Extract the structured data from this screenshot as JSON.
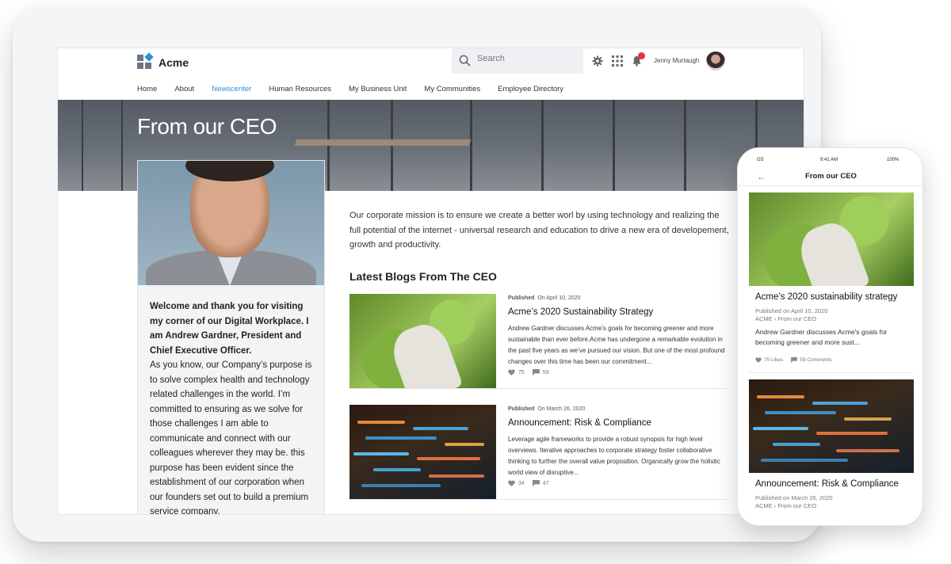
{
  "app": {
    "brand": "Acme"
  },
  "search": {
    "placeholder": "Search"
  },
  "user": {
    "name": "Jenny Murtaugh"
  },
  "nav": {
    "items": [
      "Home",
      "About",
      "Newscenter",
      "Human Resources",
      "My Business Unit",
      "My Communities",
      "Employee Directory"
    ],
    "active": "Newscenter"
  },
  "hero": {
    "title": "From our CEO"
  },
  "bio": {
    "intro": "Welcome and thank you for visiting my corner of our Digital Workplace.  I am Andrew Gardner, President and Chief Executive Officer.",
    "body": "As you know, our Company’s purpose is to solve complex health and technology related challenges in the world. I’m committed to ensuring as we solve for those challenges I am able to communicate and connect with our colleagues wherever they may be. this purpose has been evident since the establishment of our corporation when our founders set out to build a premium service company."
  },
  "mission": "Our corporate mission is to ensure we create a better worl by using technology and realizing the full potential of the internet - universal research and education to drive a new era of developement, growth and productivity.",
  "blogs": {
    "heading": "Latest Blogs From The CEO",
    "posts": [
      {
        "published_label": "Published",
        "date": "On April 10, 2020",
        "title": "Acme’s 2020 Sustainability Strategy",
        "excerpt": "Andrew Gardner discusses Acme’s goals for becoming greener and more sustainable than ever before.Acme has undergone a remarkable evolution in the past five years as we’ve pursued our vision. But one of the most profound changes over this time has been our commitment...",
        "likes": "75",
        "comments": "59"
      },
      {
        "published_label": "Published",
        "date": "On March 26, 2020",
        "title": "Announcement: Risk & Compliance",
        "excerpt": "Leverage agile frameworks to provide a robust synopsis for high level overviews. Iterative approaches to corporate strategy foster collaborative thinking to further the overall value proposition. Organically grow the holistic world view of disruptive...",
        "likes": "34",
        "comments": "47"
      }
    ]
  },
  "phone": {
    "status": {
      "carrier": "GS",
      "time": "9:41 AM",
      "battery": "100%"
    },
    "title": "From our CEO",
    "cards": [
      {
        "title": "Acme’s 2020 sustainability strategy",
        "published": "Published on April 10, 2020",
        "path_root": "ACME",
        "path_leaf": "From our CEO",
        "desc": "Andrew Gardner discusses Acme's goals for becoming greener and more sust...",
        "likes": "75 Likes",
        "comments": "59 Comments"
      },
      {
        "title": "Announcement: Risk & Compliance",
        "published": "Published on March 26, 2020",
        "path_root": "ACME",
        "path_leaf": "From our CEO"
      }
    ]
  },
  "colors": {
    "accent": "#2b8fd9",
    "notification": "#e8333a"
  }
}
